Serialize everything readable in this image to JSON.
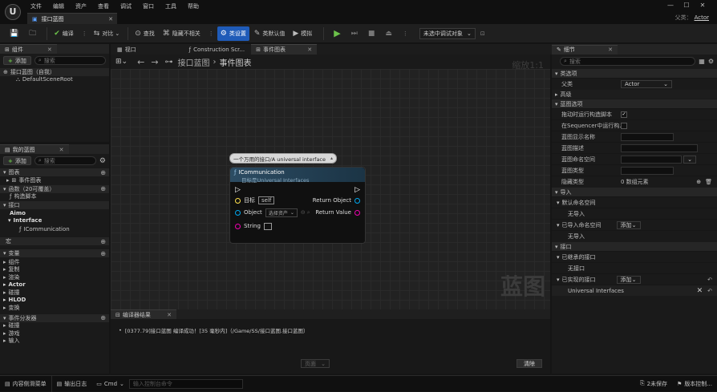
{
  "app": {
    "logo": "U",
    "menu": [
      "文件",
      "编辑",
      "资产",
      "查看",
      "调试",
      "窗口",
      "工具",
      "帮助"
    ],
    "doc_tab": "接口蓝图",
    "parent_label": "父类：",
    "parent_value": "Actor"
  },
  "toolbar": {
    "compile": "编译",
    "diff": "对比",
    "find": "查找",
    "hide_unrelated": "隐藏不相关",
    "class_settings": "类设置",
    "class_defaults": "类默认值",
    "simulate": "模拟",
    "debug_target": "未选中调试对象"
  },
  "components": {
    "title": "组件",
    "add": "添加",
    "search": "搜索",
    "root": "接口蓝图（自我）",
    "scene_root": "DefaultSceneRoot"
  },
  "viewport_tabs": {
    "viewport": "视口",
    "construction": "Construction Scr...",
    "event_graph": "事件图表"
  },
  "breadcrumb": {
    "root": "接口蓝图",
    "sep": "›",
    "current": "事件图表",
    "zoom": "缩放1:1",
    "watermark": "蓝图"
  },
  "comment": "一个万用的接口/A universal interface",
  "node": {
    "title": "ICommunication",
    "subtitle": "目标是Universal Interfaces",
    "target_label": "目标",
    "target_value": "self",
    "object_label": "Object",
    "object_select": "选择资产",
    "string_label": "String",
    "return_object": "Return Object",
    "return_value": "Return Value"
  },
  "mybp": {
    "title": "我的蓝图",
    "add": "添加",
    "search": "搜索",
    "graphs": "图表",
    "event_graph": "事件图表",
    "functions": "函数（20可覆盖）",
    "construct": "构造脚本",
    "interfaces": "接口",
    "aimo": "Aimo",
    "interface": "Interface",
    "icomm": "ICommunication",
    "macros": "宏",
    "variables": "变量",
    "var_cats": [
      "组件",
      "复制",
      "渲染",
      "Actor",
      "碰撞",
      "HLOD",
      "变换"
    ],
    "dispatchers": "事件分发器",
    "disp_cats": [
      "碰撞",
      "游戏",
      "输入"
    ]
  },
  "compiler": {
    "title": "编译器结果",
    "message": "[0377.79]接口蓝图 编译成功！[35 毫秒内]（/Game/SS/接口蓝图.接口蓝图）",
    "page": "页面",
    "clear": "清除"
  },
  "details": {
    "title": "细节",
    "search": "搜索",
    "class_options": "类选项",
    "parent": "父类",
    "parent_value": "Actor",
    "advanced": "高级",
    "bp_options": "蓝图选项",
    "run_construct": "拖动时运行构造脚本",
    "run_sequencer": "在Sequencer中运行构...",
    "display_name": "蓝图显示名称",
    "description": "蓝图描述",
    "namespace": "蓝图命名空间",
    "bp_type": "蓝图类型",
    "hide_categories": "隐藏类型",
    "array_elements": "0 数组元素",
    "imports": "导入",
    "default_ns": "默认命名空间",
    "no_import": "无导入",
    "imported_ns": "已导入命名空间",
    "add": "添加",
    "interfaces": "接口",
    "inherited": "已继承的接口",
    "no_interface": "无接口",
    "implemented": "已实现的接口",
    "implemented_item": "Universal Interfaces"
  },
  "status": {
    "drawer": "内容侧滑菜单",
    "output": "输出日志",
    "cmd": "Cmd",
    "console": "输入控制台命令",
    "unsaved": "2未保存",
    "source": "版本控制..."
  },
  "colors": {
    "accent": "#1f5bb8",
    "node_head": "#2c4c63",
    "exec_pin": "#ffffff",
    "object_pin": "#00a8f0",
    "string_pin": "#f000b0",
    "target_pin": "#ffe14d"
  }
}
